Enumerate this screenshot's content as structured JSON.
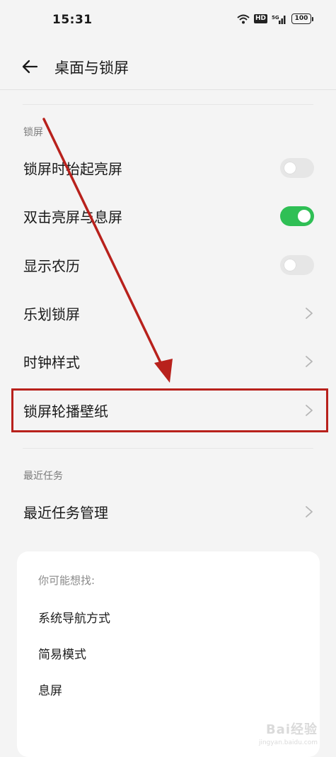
{
  "status_bar": {
    "time": "15:31",
    "hd_label": "HD",
    "network_label": "5G",
    "battery": "100"
  },
  "header": {
    "title": "桌面与锁屏",
    "back_icon": "arrow-left-icon"
  },
  "lock_section": {
    "label": "锁屏",
    "items": [
      {
        "label": "锁屏时抬起亮屏",
        "control": "toggle",
        "on": false
      },
      {
        "label": "双击亮屏与息屏",
        "control": "toggle",
        "on": true
      },
      {
        "label": "显示农历",
        "control": "toggle",
        "on": false
      },
      {
        "label": "乐划锁屏",
        "control": "chevron"
      },
      {
        "label": "时钟样式",
        "control": "chevron"
      },
      {
        "label": "锁屏轮播壁纸",
        "control": "chevron",
        "highlighted": true
      }
    ]
  },
  "recent_section": {
    "label": "最近任务",
    "items": [
      {
        "label": "最近任务管理",
        "control": "chevron"
      }
    ]
  },
  "suggestions": {
    "title": "你可能想找:",
    "items": [
      "系统导航方式",
      "简易模式",
      "息屏"
    ]
  },
  "watermark": {
    "text": "Bai经验",
    "sub": "jingyan.baidu.com"
  },
  "colors": {
    "toggle_on": "#2fbf55",
    "annotation_red": "#b8211c"
  }
}
